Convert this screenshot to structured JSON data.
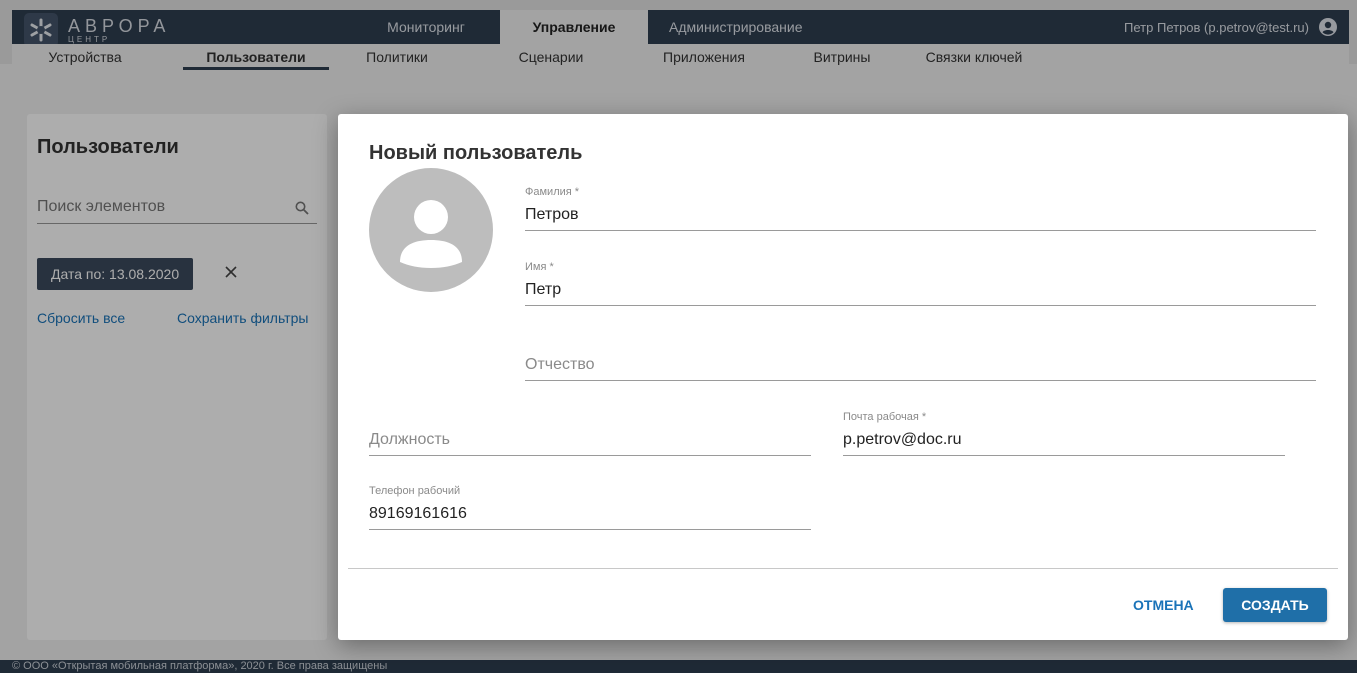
{
  "header": {
    "logo_line1": "АВРОРА",
    "logo_line2": "ЦЕНТР",
    "tabs": [
      {
        "label": "Мониторинг"
      },
      {
        "label": "Управление"
      },
      {
        "label": "Администрирование"
      }
    ],
    "user": "Петр Петров (p.petrov@test.ru)"
  },
  "subnav": {
    "items": [
      {
        "label": "Устройства"
      },
      {
        "label": "Пользователи"
      },
      {
        "label": "Политики"
      },
      {
        "label": "Сценарии"
      },
      {
        "label": "Приложения"
      },
      {
        "label": "Витрины"
      },
      {
        "label": "Связки ключей"
      }
    ]
  },
  "left_panel": {
    "title": "Пользователи",
    "search_placeholder": "Поиск элементов",
    "filter_chip": "Дата по: 13.08.2020",
    "reset_all": "Сбросить все",
    "save_filters": "Сохранить фильтры"
  },
  "modal": {
    "title": "Новый пользователь",
    "last_name": {
      "label": "Фамилия *",
      "value": "Петров"
    },
    "first_name": {
      "label": "Имя *",
      "value": "Петр"
    },
    "middle_name": {
      "placeholder": "Отчество"
    },
    "position": {
      "placeholder": "Должность"
    },
    "work_email": {
      "label": "Почта рабочая *",
      "value": "p.petrov@doc.ru"
    },
    "work_phone": {
      "label": "Телефон рабочий",
      "value": "89169161616"
    },
    "cancel_label": "ОТМЕНА",
    "create_label": "СОЗДАТЬ"
  },
  "footer": {
    "text": "© ООО «Открытая мобильная платформа», 2020 г. Все права защищены"
  },
  "colors": {
    "nav_bg": "#2f3e50",
    "accent": "#1f6fa8",
    "link": "#1a73b8"
  }
}
